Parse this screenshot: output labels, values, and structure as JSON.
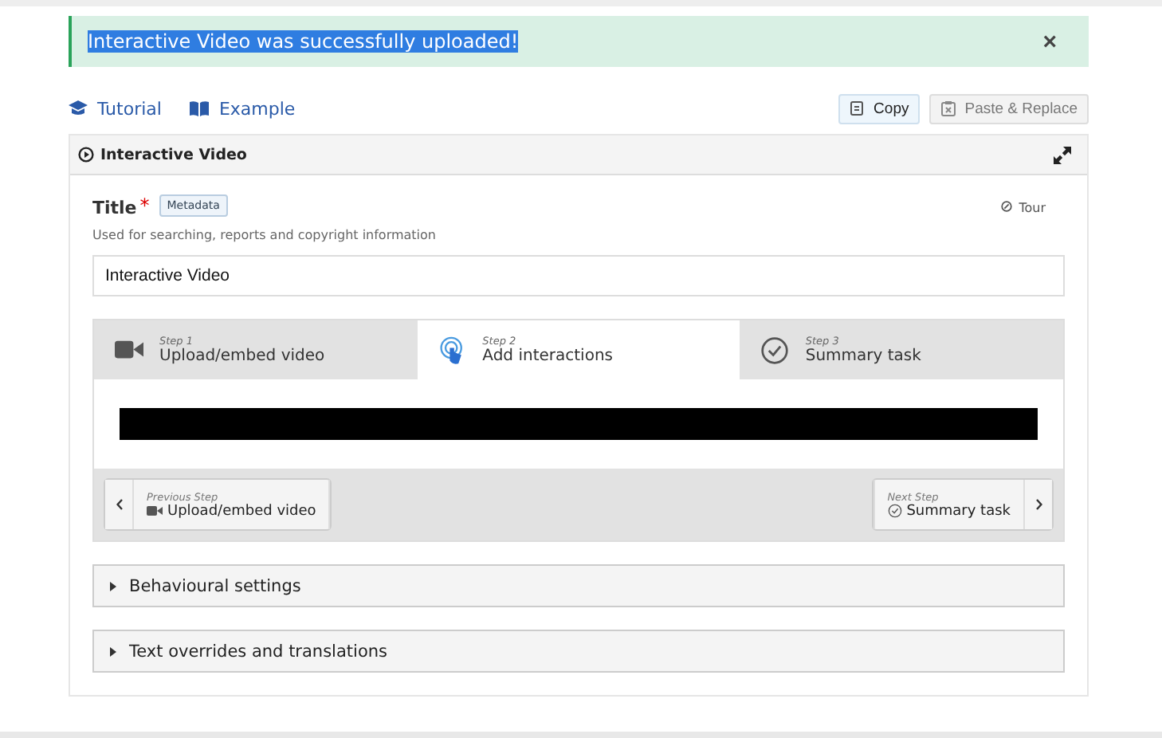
{
  "notice": {
    "text": "Interactive Video was successfully uploaded!",
    "highlighted": true,
    "close": "×"
  },
  "links": [
    {
      "label": "Tutorial",
      "kind": "tutorial"
    },
    {
      "label": "Example",
      "kind": "example"
    }
  ],
  "actions": [
    {
      "label": "Copy",
      "disabled": false,
      "kind": "copy"
    },
    {
      "label": "Paste & Replace",
      "disabled": true,
      "kind": "paste"
    }
  ],
  "panel": {
    "title": "Interactive Video"
  },
  "field": {
    "label": "Title",
    "required": true,
    "required_mark": "*",
    "badge": "Metadata",
    "tour": "Tour",
    "description": "Used for searching, reports and copyright information",
    "value": "Interactive Video"
  },
  "steps": [
    {
      "step": "Step 1",
      "label": "Upload/embed video",
      "selected": false,
      "kind": "video"
    },
    {
      "step": "Step 2",
      "label": "Add interactions",
      "selected": true,
      "kind": "touch"
    },
    {
      "step": "Step 3",
      "label": "Summary task",
      "selected": false,
      "kind": "check"
    }
  ],
  "nav": {
    "previous": {
      "caption": "Previous Step",
      "label": "Upload/embed video"
    },
    "next": {
      "caption": "Next Step",
      "label": "Summary task"
    }
  },
  "sections": [
    {
      "label": "Behavioural settings",
      "expanded": false
    },
    {
      "label": "Text overrides and translations",
      "expanded": false
    }
  ]
}
